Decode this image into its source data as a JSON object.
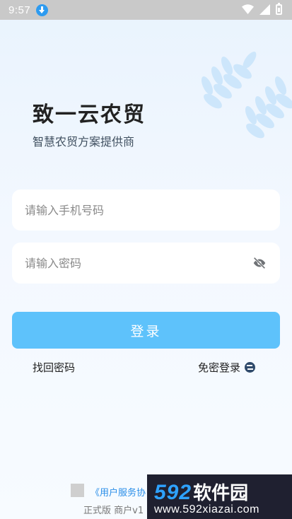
{
  "status_bar": {
    "time": "9:57",
    "icons": [
      "download-icon",
      "wifi-icon",
      "signal-icon",
      "battery-icon"
    ]
  },
  "header": {
    "title": "致一云农贸",
    "subtitle": "智慧农贸方案提供商"
  },
  "form": {
    "phone_placeholder": "请输入手机号码",
    "password_placeholder": "请输入密码",
    "login_label": "登录"
  },
  "links": {
    "forgot_password": "找回密码",
    "password_free_login": "免密登录"
  },
  "footer": {
    "agreement": "《用户服务协",
    "version": "正式版 商户v1"
  },
  "watermark": {
    "number": "592",
    "name": "软件园",
    "url": "www.592xiazai.com"
  },
  "colors": {
    "accent": "#5ec2fb",
    "link": "#2a8ee8",
    "watermark_bg": "#1f2030",
    "watermark_blue": "#2ea2ff"
  }
}
